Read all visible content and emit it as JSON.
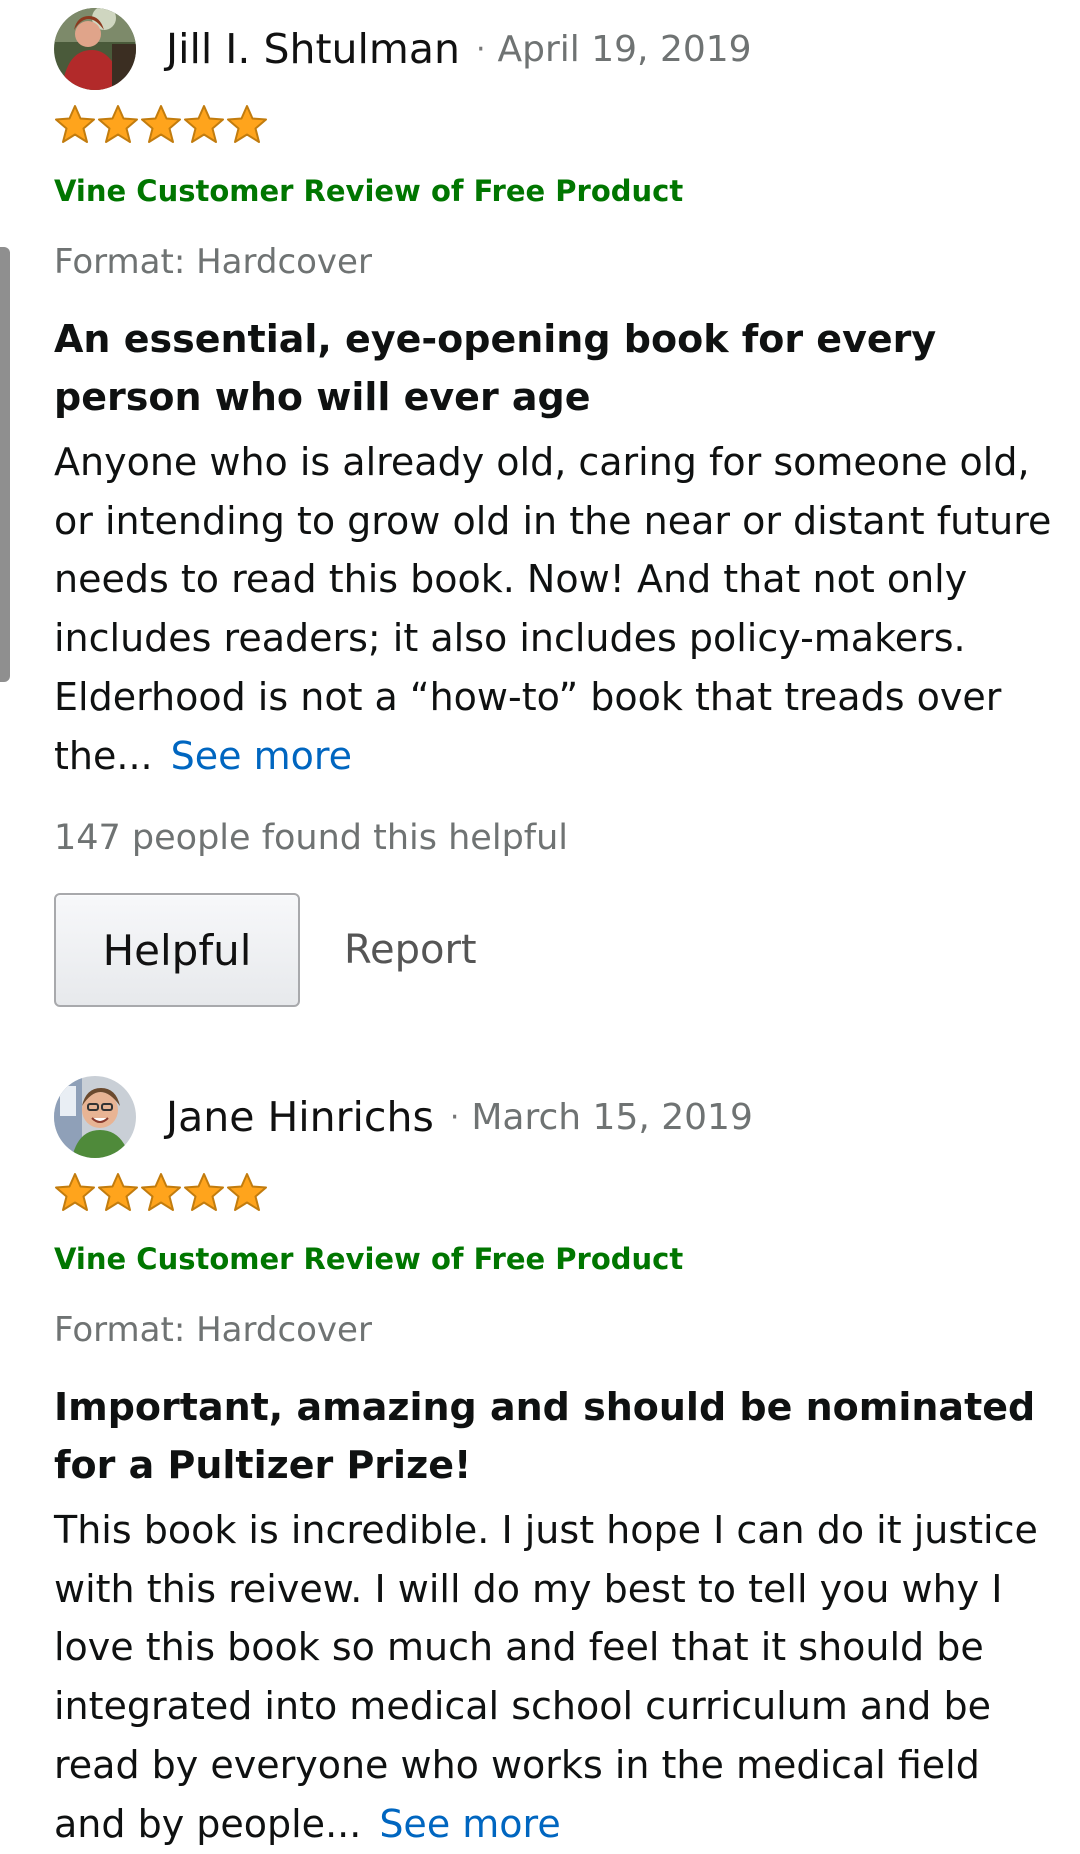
{
  "colors": {
    "vine_green": "#007600",
    "link_blue": "#0066c0",
    "star_gold": "#ffa41c",
    "meta_gray": "#6f7373"
  },
  "icons": {
    "star": "star-icon",
    "avatar": "user-avatar"
  },
  "reviews": [
    {
      "reviewer": "Jill I. Shtulman",
      "separator": "·",
      "date": "April 19, 2019",
      "rating": 5,
      "rating_max": 5,
      "badge": "Vine Customer Review of Free Product",
      "format": "Format: Hardcover",
      "title": "An essential, eye-opening book for every person who will ever age",
      "body": "Anyone who is already old, caring for someone old, or intending to grow old in the near or distant future needs to read this book. Now! And that not only includes readers; it also includes policy-makers. Elderhood is not a “how-to” book that treads over the...",
      "see_more": "See more",
      "helpful_count": "147 people found this helpful",
      "helpful_button": "Helpful",
      "report_link": "Report"
    },
    {
      "reviewer": "Jane Hinrichs",
      "separator": "·",
      "date": "March 15, 2019",
      "rating": 5,
      "rating_max": 5,
      "badge": "Vine Customer Review of Free Product",
      "format": "Format: Hardcover",
      "title": "Important, amazing and should be nominated for a Pultizer Prize!",
      "body": "This book is incredible. I just hope I can do it justice with this reivew. I will do my best to tell you why I love this book so much and feel that it should be integrated into medical school curriculum and be read by everyone who works in the medical field and by people...",
      "see_more": "See more"
    }
  ]
}
